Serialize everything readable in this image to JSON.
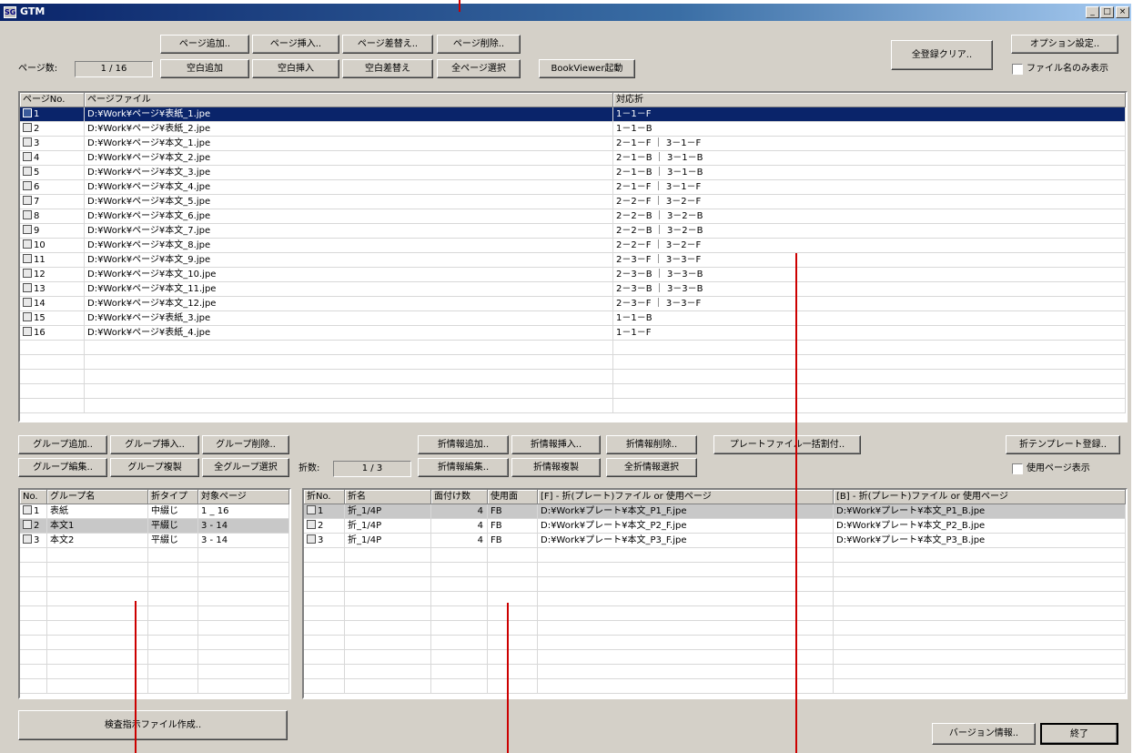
{
  "window": {
    "title": "GTM",
    "app_icon": "SG",
    "min_glyph": "_",
    "max_glyph": "□",
    "close_glyph": "×"
  },
  "page_toolbar": {
    "add_page": "ページ追加..",
    "insert_page": "ページ挿入..",
    "replace_page": "ページ差替え..",
    "delete_page": "ページ削除..",
    "add_blank": "空白追加",
    "insert_blank": "空白挿入",
    "replace_blank": "空白差替え",
    "select_all_pages": "全ページ選択",
    "book_viewer": "BookViewer起動",
    "page_count_label": "ページ数:",
    "page_count": "1 / 16"
  },
  "top_right": {
    "clear_all": "全登録クリア..",
    "options": "オプション設定..",
    "filename_only": "ファイル名のみ表示"
  },
  "pages": {
    "headers": [
      "ページNo.",
      "ページファイル",
      "対応折"
    ],
    "rows": [
      [
        "1",
        "D:¥Work¥ページ¥表紙_1.jpe",
        "1－1－F"
      ],
      [
        "2",
        "D:¥Work¥ページ¥表紙_2.jpe",
        "1－1－B"
      ],
      [
        "3",
        "D:¥Work¥ページ¥本文_1.jpe",
        "2－1－F ｜ 3－1－F"
      ],
      [
        "4",
        "D:¥Work¥ページ¥本文_2.jpe",
        "2－1－B ｜ 3－1－B"
      ],
      [
        "5",
        "D:¥Work¥ページ¥本文_3.jpe",
        "2－1－B ｜ 3－1－B"
      ],
      [
        "6",
        "D:¥Work¥ページ¥本文_4.jpe",
        "2－1－F ｜ 3－1－F"
      ],
      [
        "7",
        "D:¥Work¥ページ¥本文_5.jpe",
        "2－2－F ｜ 3－2－F"
      ],
      [
        "8",
        "D:¥Work¥ページ¥本文_6.jpe",
        "2－2－B ｜ 3－2－B"
      ],
      [
        "9",
        "D:¥Work¥ページ¥本文_7.jpe",
        "2－2－B ｜ 3－2－B"
      ],
      [
        "10",
        "D:¥Work¥ページ¥本文_8.jpe",
        "2－2－F ｜ 3－2－F"
      ],
      [
        "11",
        "D:¥Work¥ページ¥本文_9.jpe",
        "2－3－F ｜ 3－3－F"
      ],
      [
        "12",
        "D:¥Work¥ページ¥本文_10.jpe",
        "2－3－B ｜ 3－3－B"
      ],
      [
        "13",
        "D:¥Work¥ページ¥本文_11.jpe",
        "2－3－B ｜ 3－3－B"
      ],
      [
        "14",
        "D:¥Work¥ページ¥本文_12.jpe",
        "2－3－F ｜ 3－3－F"
      ],
      [
        "15",
        "D:¥Work¥ページ¥表紙_3.jpe",
        "1－1－B"
      ],
      [
        "16",
        "D:¥Work¥ページ¥表紙_4.jpe",
        "1－1－F"
      ]
    ]
  },
  "group_toolbar": {
    "add": "グループ追加..",
    "insert": "グループ挿入..",
    "delete": "グループ削除..",
    "edit": "グループ編集..",
    "copy": "グループ複製",
    "select_all": "全グループ選択"
  },
  "fold_toolbar": {
    "add": "折情報追加..",
    "insert": "折情報挿入..",
    "delete": "折情報削除..",
    "plate_assign": "プレートファイル一括割付..",
    "edit": "折情報編集..",
    "copy": "折情報複製",
    "select_all": "全折情報選択",
    "count_label": "折数:",
    "count": "1 / 3",
    "template": "折テンプレート登録..",
    "show_used_pages": "使用ページ表示"
  },
  "groups": {
    "headers": [
      "No.",
      "グループ名",
      "折タイプ",
      "対象ページ"
    ],
    "rows": [
      [
        "1",
        "表紙",
        "中綴じ",
        "1 _ 16"
      ],
      [
        "2",
        "本文1",
        "平綴じ",
        "3 - 14"
      ],
      [
        "3",
        "本文2",
        "平綴じ",
        "3 - 14"
      ]
    ]
  },
  "folds": {
    "headers": [
      "折No.",
      "折名",
      "面付け数",
      "使用面",
      "[F] - 折(プレート)ファイル or 使用ページ",
      "[B] - 折(プレート)ファイル or 使用ページ"
    ],
    "rows": [
      [
        "1",
        "折_1/4P",
        "4",
        "FB",
        "D:¥Work¥プレート¥本文_P1_F.jpe",
        "D:¥Work¥プレート¥本文_P1_B.jpe"
      ],
      [
        "2",
        "折_1/4P",
        "4",
        "FB",
        "D:¥Work¥プレート¥本文_P2_F.jpe",
        "D:¥Work¥プレート¥本文_P2_B.jpe"
      ],
      [
        "3",
        "折_1/4P",
        "4",
        "FB",
        "D:¥Work¥プレート¥本文_P3_F.jpe",
        "D:¥Work¥プレート¥本文_P3_B.jpe"
      ]
    ]
  },
  "bottom": {
    "make_index_file": "検査指示ファイル作成..",
    "version": "バージョン情報..",
    "exit": "終了"
  },
  "colors": {
    "selection": "#0a246a",
    "annotation_line": "#cc0000",
    "face": "#d4d0c8"
  }
}
